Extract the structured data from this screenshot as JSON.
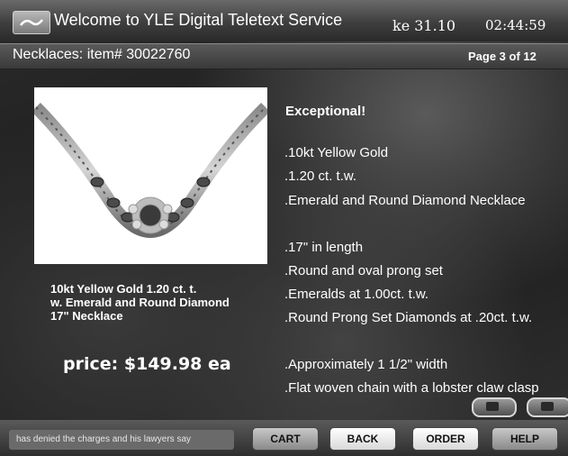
{
  "header": {
    "welcome": "Welcome to YLE Digital Teletext Service",
    "date": "ke 31.10",
    "time": "02:44:59",
    "logo_icon": "tv-logo-icon"
  },
  "subheader": {
    "item_title": "Necklaces: item# 30022760",
    "page_indicator": "Page 3 of 12"
  },
  "product": {
    "image": "necklace-photo",
    "caption_lines": [
      "10kt Yellow Gold 1.20 ct. t.",
      "w. Emerald and Round Diamond",
      "17\" Necklace"
    ],
    "price": "price: $149.98 ea",
    "headline": "Exceptional!",
    "specs": [
      ".10kt Yellow Gold",
      ".1.20 ct. t.w.",
      ".Emerald and Round Diamond Necklace",
      ".17\" in length",
      ".Round and oval prong set",
      ".Emeralds at 1.00ct. t.w.",
      ".Round Prong Set Diamonds at .20ct. t.w.",
      ".Approximately 1 1/2\" width",
      ".Flat woven chain with a lobster claw clasp"
    ]
  },
  "footer": {
    "ticker": "has denied the charges and his lawyers say",
    "buttons": {
      "cart": "CART",
      "back": "BACK",
      "order": "ORDER",
      "help": "HELP"
    }
  }
}
